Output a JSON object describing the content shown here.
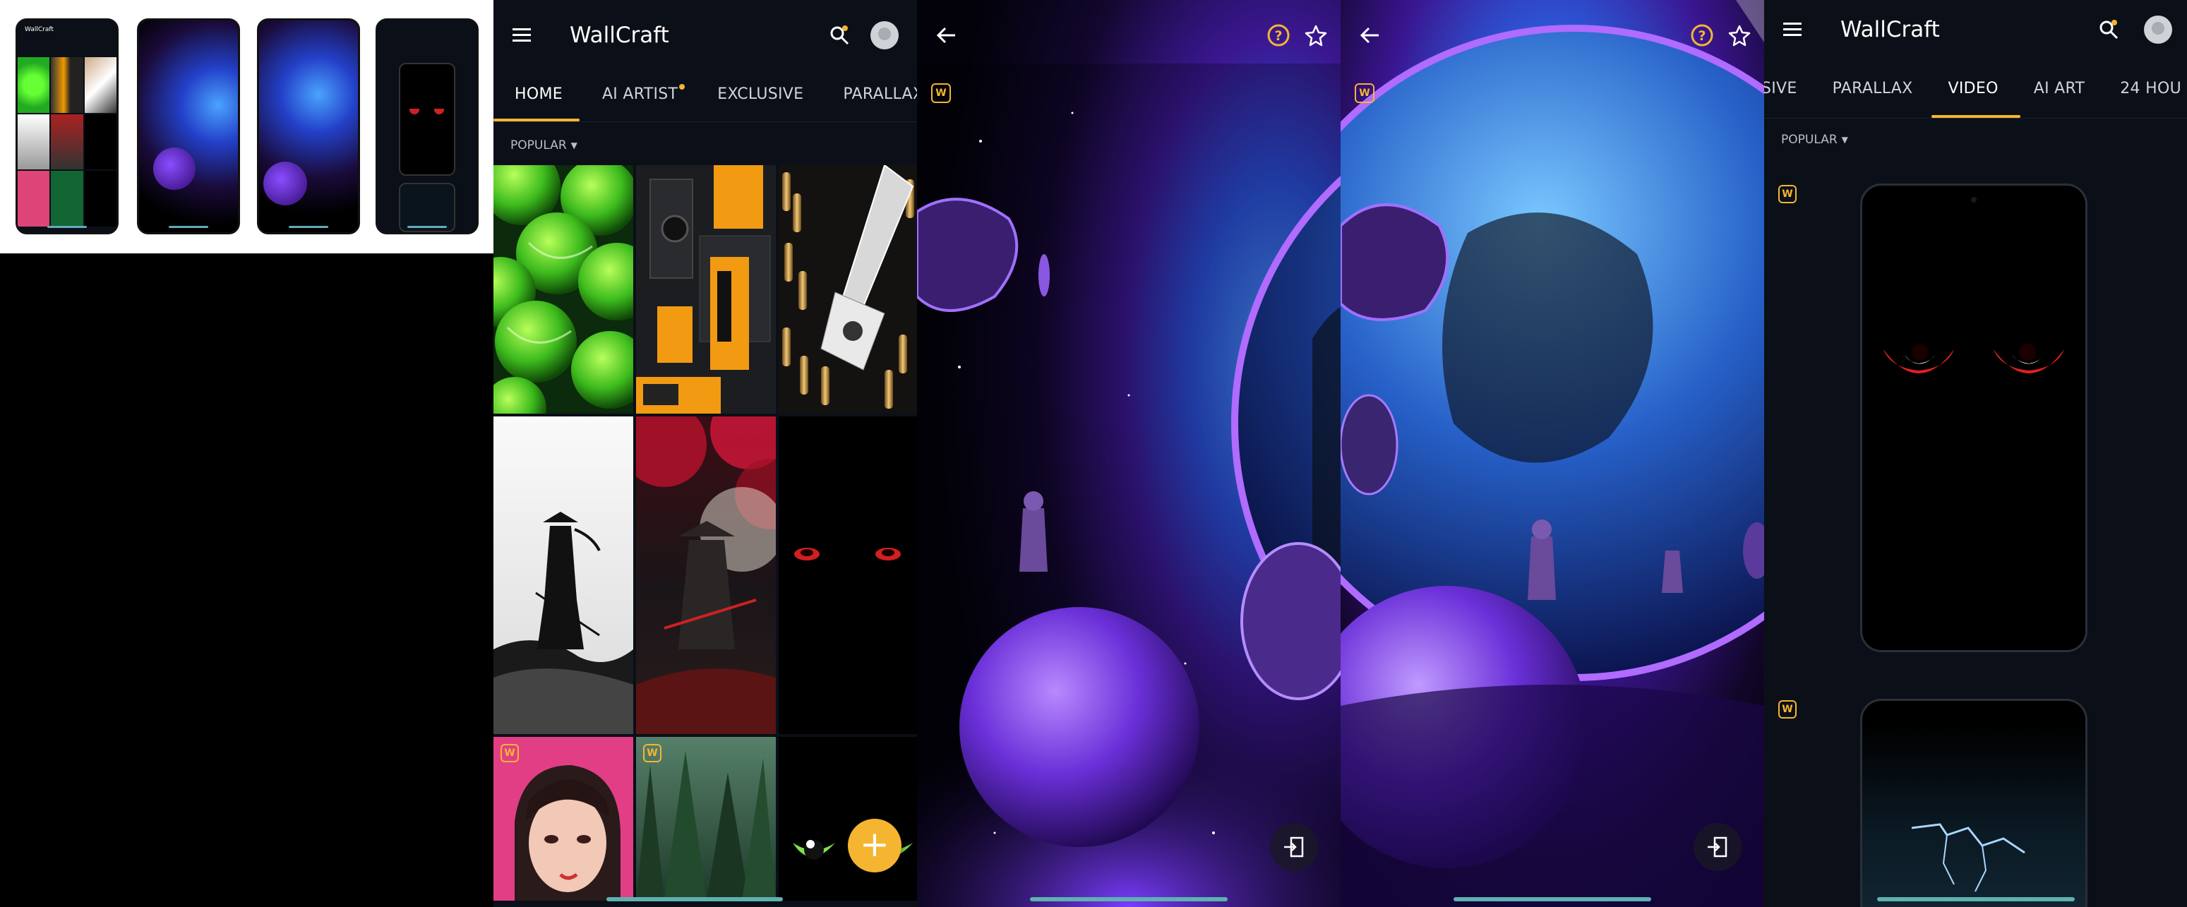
{
  "app": {
    "title": "WallCraft"
  },
  "home": {
    "tabs": [
      {
        "label": "HOME",
        "active": true
      },
      {
        "label": "AI ARTIST",
        "dot": true
      },
      {
        "label": "EXCLUSIVE"
      },
      {
        "label": "PARALLAX"
      }
    ],
    "filter": "POPULAR",
    "fab": "+"
  },
  "video": {
    "tabs": [
      {
        "label": "SIVE"
      },
      {
        "label": "PARALLAX"
      },
      {
        "label": "VIDEO",
        "active": true
      },
      {
        "label": "AI ART"
      },
      {
        "label": "24 HOU"
      }
    ],
    "filter": "POPULAR"
  },
  "badge": "W",
  "colors": {
    "accent": "#f5b531",
    "background": "#0b0f17",
    "nav": "#5fb0b0"
  },
  "icons": [
    "menu-icon",
    "search-icon",
    "avatar",
    "back-icon",
    "help-icon",
    "star-icon",
    "set-wallpaper-icon",
    "add-icon"
  ]
}
